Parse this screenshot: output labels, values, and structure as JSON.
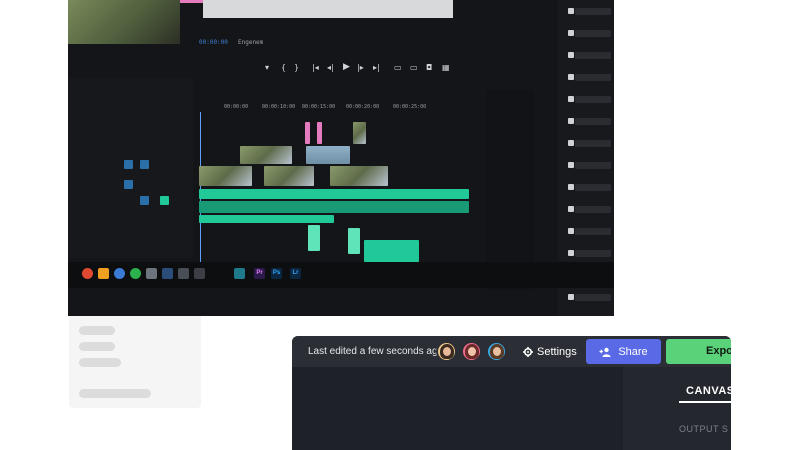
{
  "editor": {
    "timecode": "00:00:00",
    "dropdown": "Engenem",
    "ruler": [
      "00:00:00",
      "00:00:10:00",
      "00:00:15:00",
      "00:00:20:00",
      "00:00:25:00"
    ],
    "taskbar_apps": [
      {
        "icon": "premiere-icon",
        "label": "Pr",
        "color": "#2c1a4a",
        "text": "#e77bff"
      },
      {
        "icon": "photoshop-icon",
        "label": "Ps",
        "color": "#0b2740",
        "text": "#31a8ff"
      },
      {
        "icon": "lightroom-icon",
        "label": "Lr",
        "color": "#0b2740",
        "text": "#31a8ff"
      }
    ]
  },
  "toolbar": {
    "last_edited": "Last edited a few seconds ago.",
    "avatars": [
      {
        "name": "collaborator-avatar-1",
        "ring": "#e9c58a",
        "hair": "#3b2a1f",
        "face": "#e7b999"
      },
      {
        "name": "collaborator-avatar-2",
        "ring": "#f06a8a",
        "hair": "#6b2b2b",
        "face": "#f1c4a9"
      },
      {
        "name": "collaborator-avatar-3",
        "ring": "#3aa7e0",
        "hair": "#5a3a24",
        "face": "#e8bfa0"
      }
    ],
    "settings_label": "Settings",
    "share_label": "Share",
    "export_label": "Expo",
    "canvas_tab": "CANVAS",
    "output_label": "OUTPUT S",
    "colors": {
      "share": "#5a6ae6",
      "export": "#5ad27a",
      "bar": "#2b2e34"
    }
  }
}
